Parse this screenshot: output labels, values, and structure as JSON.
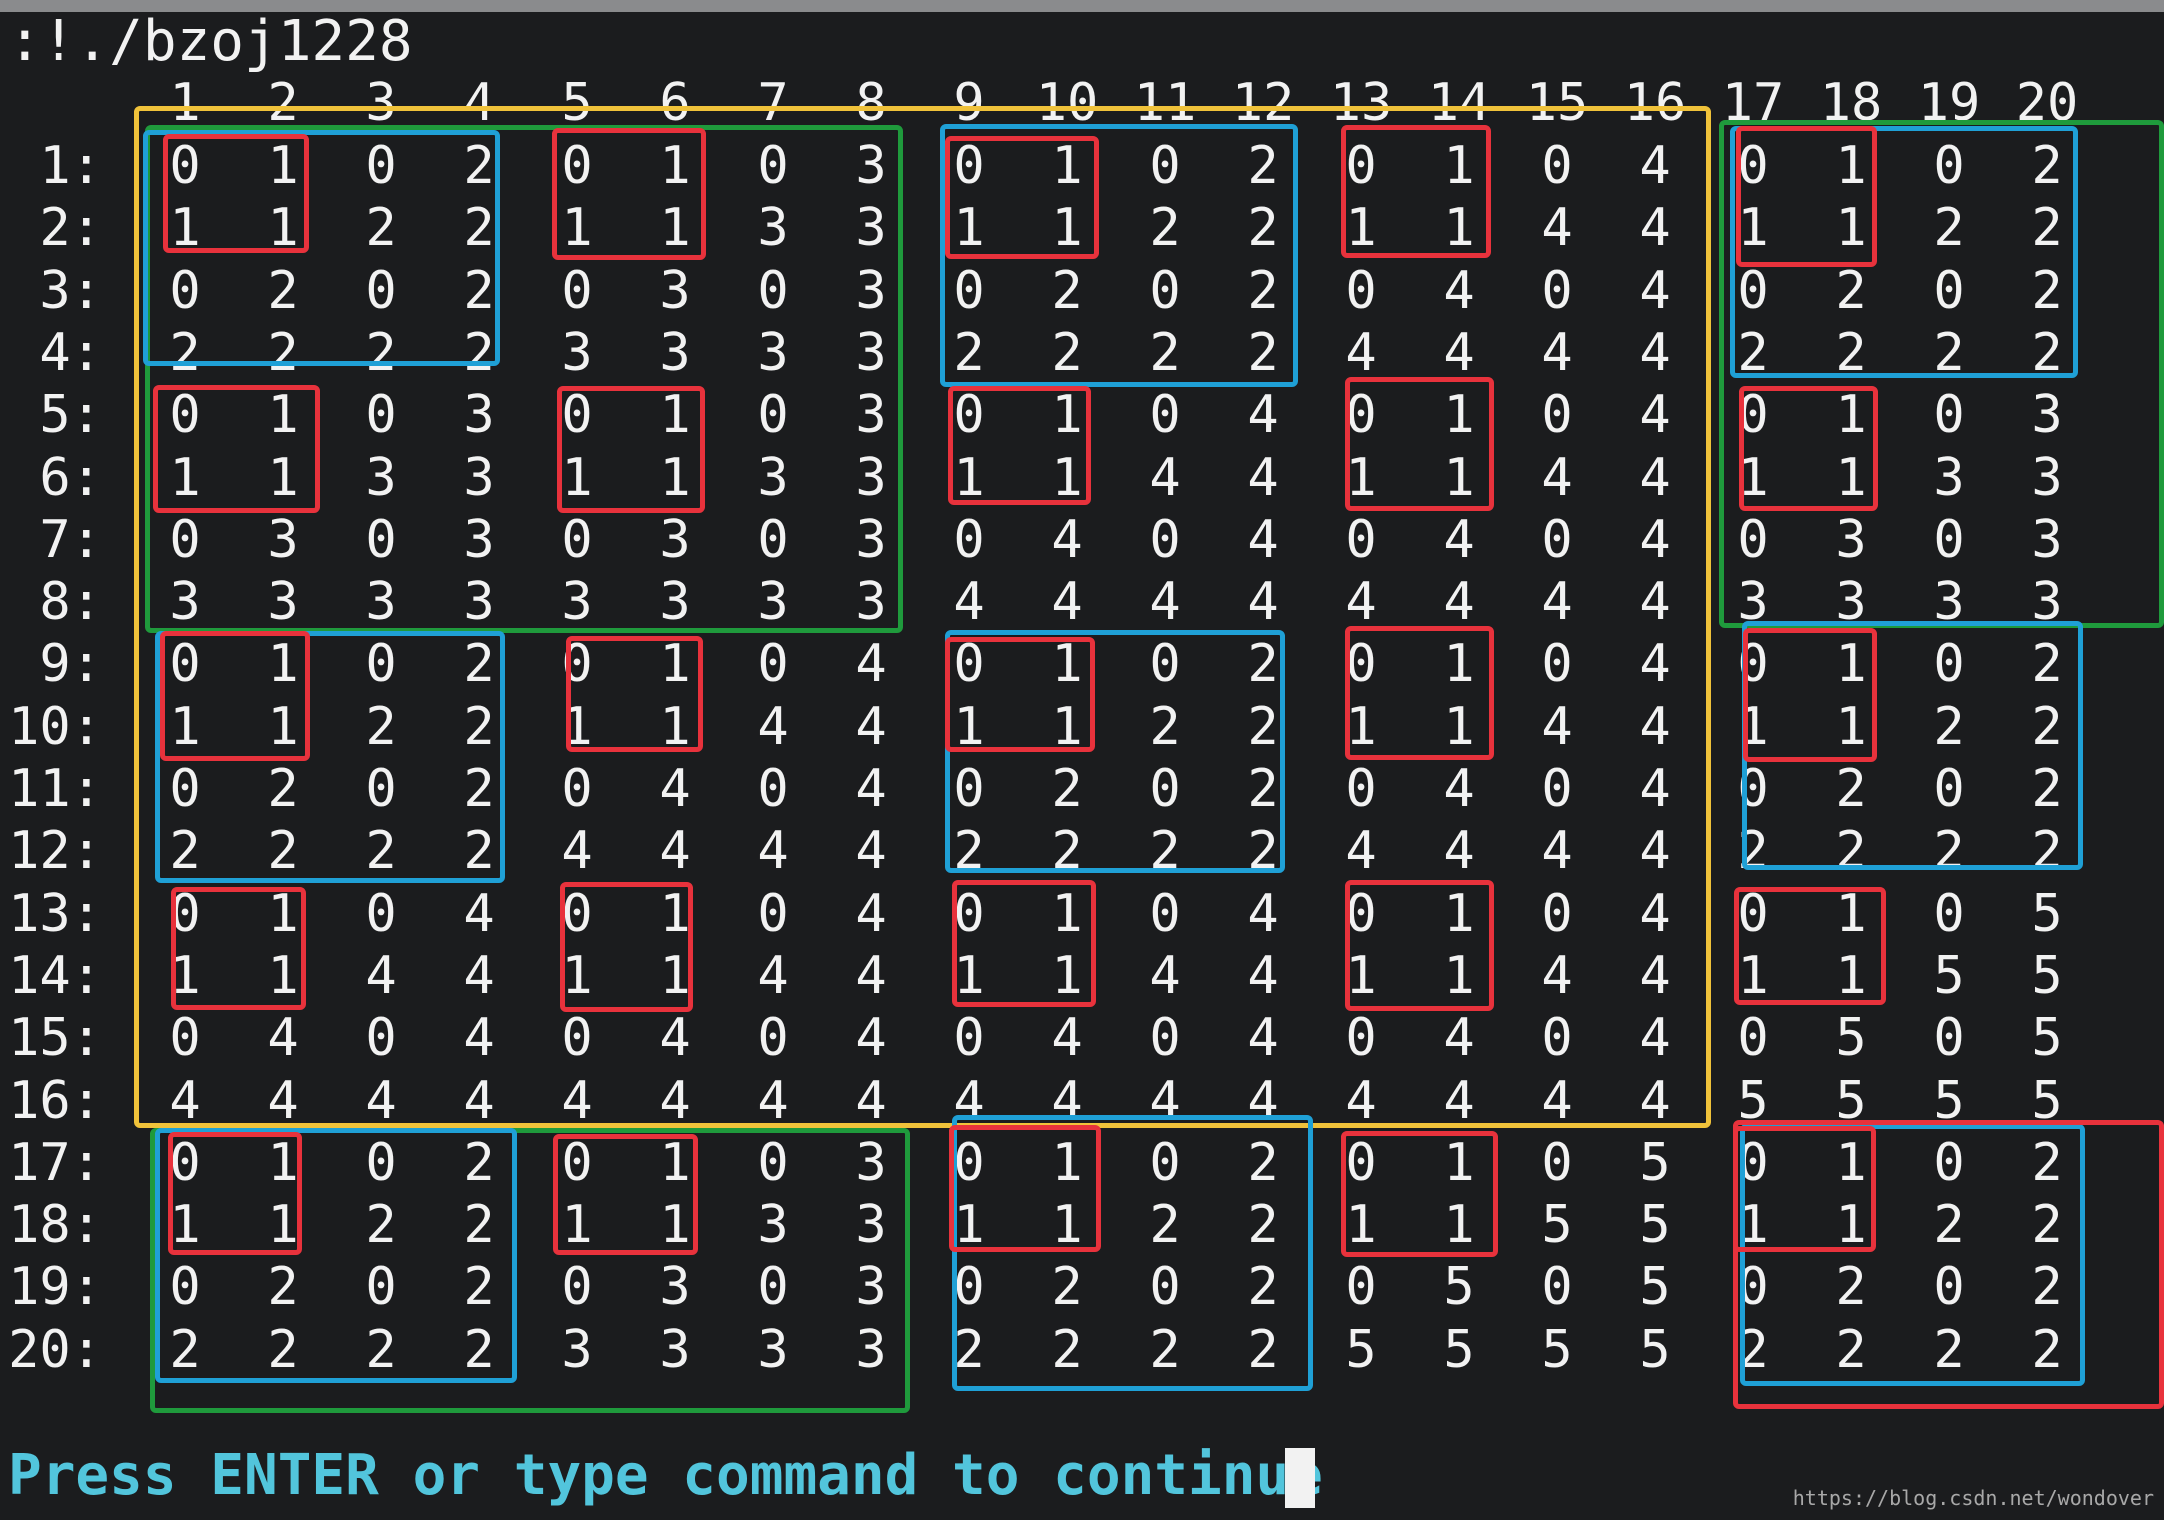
{
  "terminal": {
    "command_line": ":!./bzoj1228",
    "column_numbers": [
      "1",
      "2",
      "3",
      "4",
      "5",
      "6",
      "7",
      "8",
      "9",
      "10",
      "11",
      "12",
      "13",
      "14",
      "15",
      "16",
      "17",
      "18",
      "19",
      "20"
    ],
    "row_labels": [
      "1:",
      "2:",
      "3:",
      "4:",
      "5:",
      "6:",
      "7:",
      "8:",
      "9:",
      "10:",
      "11:",
      "12:",
      "13:",
      "14:",
      "15:",
      "16:",
      "17:",
      "18:",
      "19:",
      "20:"
    ],
    "grid": [
      [
        "0",
        "1",
        "0",
        "2",
        "0",
        "1",
        "0",
        "3",
        "0",
        "1",
        "0",
        "2",
        "0",
        "1",
        "0",
        "4",
        "0",
        "1",
        "0",
        "2"
      ],
      [
        "1",
        "1",
        "2",
        "2",
        "1",
        "1",
        "3",
        "3",
        "1",
        "1",
        "2",
        "2",
        "1",
        "1",
        "4",
        "4",
        "1",
        "1",
        "2",
        "2"
      ],
      [
        "0",
        "2",
        "0",
        "2",
        "0",
        "3",
        "0",
        "3",
        "0",
        "2",
        "0",
        "2",
        "0",
        "4",
        "0",
        "4",
        "0",
        "2",
        "0",
        "2"
      ],
      [
        "2",
        "2",
        "2",
        "2",
        "3",
        "3",
        "3",
        "3",
        "2",
        "2",
        "2",
        "2",
        "4",
        "4",
        "4",
        "4",
        "2",
        "2",
        "2",
        "2"
      ],
      [
        "0",
        "1",
        "0",
        "3",
        "0",
        "1",
        "0",
        "3",
        "0",
        "1",
        "0",
        "4",
        "0",
        "1",
        "0",
        "4",
        "0",
        "1",
        "0",
        "3"
      ],
      [
        "1",
        "1",
        "3",
        "3",
        "1",
        "1",
        "3",
        "3",
        "1",
        "1",
        "4",
        "4",
        "1",
        "1",
        "4",
        "4",
        "1",
        "1",
        "3",
        "3"
      ],
      [
        "0",
        "3",
        "0",
        "3",
        "0",
        "3",
        "0",
        "3",
        "0",
        "4",
        "0",
        "4",
        "0",
        "4",
        "0",
        "4",
        "0",
        "3",
        "0",
        "3"
      ],
      [
        "3",
        "3",
        "3",
        "3",
        "3",
        "3",
        "3",
        "3",
        "4",
        "4",
        "4",
        "4",
        "4",
        "4",
        "4",
        "4",
        "3",
        "3",
        "3",
        "3"
      ],
      [
        "0",
        "1",
        "0",
        "2",
        "0",
        "1",
        "0",
        "4",
        "0",
        "1",
        "0",
        "2",
        "0",
        "1",
        "0",
        "4",
        "0",
        "1",
        "0",
        "2"
      ],
      [
        "1",
        "1",
        "2",
        "2",
        "1",
        "1",
        "4",
        "4",
        "1",
        "1",
        "2",
        "2",
        "1",
        "1",
        "4",
        "4",
        "1",
        "1",
        "2",
        "2"
      ],
      [
        "0",
        "2",
        "0",
        "2",
        "0",
        "4",
        "0",
        "4",
        "0",
        "2",
        "0",
        "2",
        "0",
        "4",
        "0",
        "4",
        "0",
        "2",
        "0",
        "2"
      ],
      [
        "2",
        "2",
        "2",
        "2",
        "4",
        "4",
        "4",
        "4",
        "2",
        "2",
        "2",
        "2",
        "4",
        "4",
        "4",
        "4",
        "2",
        "2",
        "2",
        "2"
      ],
      [
        "0",
        "1",
        "0",
        "4",
        "0",
        "1",
        "0",
        "4",
        "0",
        "1",
        "0",
        "4",
        "0",
        "1",
        "0",
        "4",
        "0",
        "1",
        "0",
        "5"
      ],
      [
        "1",
        "1",
        "4",
        "4",
        "1",
        "1",
        "4",
        "4",
        "1",
        "1",
        "4",
        "4",
        "1",
        "1",
        "4",
        "4",
        "1",
        "1",
        "5",
        "5"
      ],
      [
        "0",
        "4",
        "0",
        "4",
        "0",
        "4",
        "0",
        "4",
        "0",
        "4",
        "0",
        "4",
        "0",
        "4",
        "0",
        "4",
        "0",
        "5",
        "0",
        "5"
      ],
      [
        "4",
        "4",
        "4",
        "4",
        "4",
        "4",
        "4",
        "4",
        "4",
        "4",
        "4",
        "4",
        "4",
        "4",
        "4",
        "4",
        "5",
        "5",
        "5",
        "5"
      ],
      [
        "0",
        "1",
        "0",
        "2",
        "0",
        "1",
        "0",
        "3",
        "0",
        "1",
        "0",
        "2",
        "0",
        "1",
        "0",
        "5",
        "0",
        "1",
        "0",
        "2"
      ],
      [
        "1",
        "1",
        "2",
        "2",
        "1",
        "1",
        "3",
        "3",
        "1",
        "1",
        "2",
        "2",
        "1",
        "1",
        "5",
        "5",
        "1",
        "1",
        "2",
        "2"
      ],
      [
        "0",
        "2",
        "0",
        "2",
        "0",
        "3",
        "0",
        "3",
        "0",
        "2",
        "0",
        "2",
        "0",
        "5",
        "0",
        "5",
        "0",
        "2",
        "0",
        "2"
      ],
      [
        "2",
        "2",
        "2",
        "2",
        "3",
        "3",
        "3",
        "3",
        "2",
        "2",
        "2",
        "2",
        "5",
        "5",
        "5",
        "5",
        "2",
        "2",
        "2",
        "2"
      ]
    ],
    "prompt": "Press ENTER or type command to continue",
    "watermark": "https://blog.csdn.net/wondover"
  },
  "colors": {
    "background": "#1b1c1e",
    "text": "#f2f2f2",
    "prompt": "#52c5dc",
    "red": "#e8323c",
    "blue": "#1fa0d6",
    "green": "#1f9a3c",
    "yellow": "#f0c23a"
  }
}
